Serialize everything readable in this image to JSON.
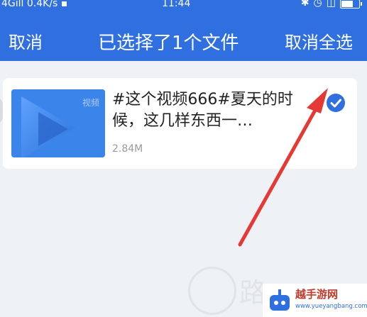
{
  "status_bar": {
    "network": "4G",
    "signal": "ıll",
    "speed": "0.4K/s",
    "time": "11:44"
  },
  "top_bar": {
    "cancel_label": "取消",
    "title": "已选择了1个文件",
    "deselect_all_label": "取消全选"
  },
  "file": {
    "thumbnail_label": "视频",
    "name": "#这个视频666#夏天的时候，这几样东西一…",
    "size": "2.84M",
    "selected": true
  },
  "watermark": {
    "big_char": "路",
    "title": "越手游网",
    "url": "www.yueyangbang.com"
  },
  "colors": {
    "accent": "#2f6fe0",
    "background": "#eef1f5",
    "arrow": "#e53935"
  }
}
